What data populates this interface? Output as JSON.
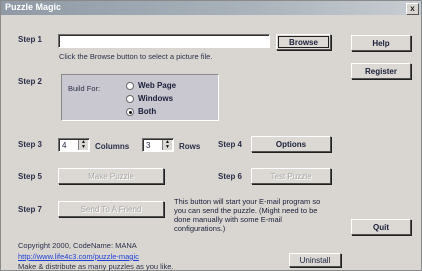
{
  "window": {
    "title": "Puzzle Magic",
    "close_label": "x"
  },
  "step1": {
    "label": "Step 1",
    "hint": "Click the Browse button to select a picture file.",
    "file_value": "",
    "browse_label": "Browse"
  },
  "step2": {
    "label": "Step 2",
    "build_for_label": "Build For:",
    "options": [
      {
        "label": "Web Page",
        "selected": false
      },
      {
        "label": "Windows",
        "selected": false
      },
      {
        "label": "Both",
        "selected": true
      }
    ]
  },
  "step3": {
    "label": "Step 3",
    "columns_value": "4",
    "columns_label": "Columns",
    "rows_value": "3",
    "rows_label": "Rows"
  },
  "step4": {
    "label": "Step 4",
    "options_label": "Options"
  },
  "step5": {
    "label": "Step 5",
    "make_puzzle_label": "Make Puzzle"
  },
  "step6": {
    "label": "Step 6",
    "test_puzzle_label": "Test Puzzle"
  },
  "step7": {
    "label": "Step 7",
    "send_label": "Send To A Friend",
    "description_lines": [
      "This button will start your E-mail program so",
      "you can send the puzzle. (Might need to be",
      "done manually with some E-mail",
      "configurations.)"
    ]
  },
  "side": {
    "help_label": "Help",
    "register_label": "Register",
    "quit_label": "Quit"
  },
  "footer": {
    "copyright": "Copyright 2000, CodeName: MANA",
    "url": "http://www.life4c3.com/puzzle-magic",
    "tagline": "Make & distribute as many puzzles as you like.",
    "uninstall_label": "Uninstall"
  }
}
